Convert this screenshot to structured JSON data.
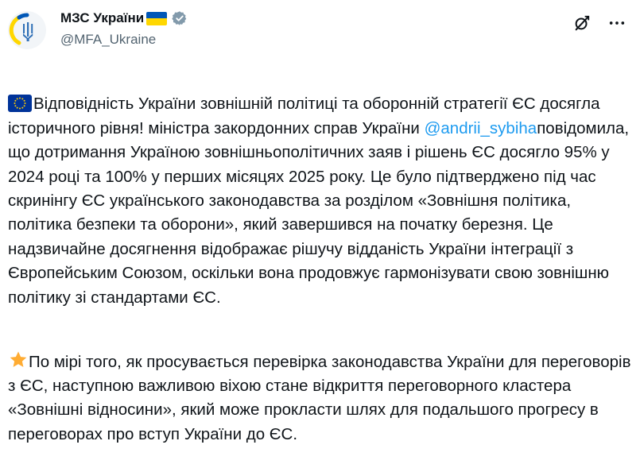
{
  "author": {
    "display_name": "МЗС України",
    "handle": "@MFA_Ukraine"
  },
  "icons": {
    "avatar": "trident-logo",
    "verified": "verified-badge-icon",
    "grok": "grok-icon",
    "more": "more-icon"
  },
  "colors": {
    "accent": "#1d9bf0",
    "ua_blue": "#0057b7",
    "ua_yellow": "#ffd700",
    "eu_blue": "#003399",
    "star": "#ffac33"
  },
  "post": {
    "para1": {
      "text_before": "Відповідність України зовнішній політиці та оборонній стратегії ЄС досягла історичного рівня! міністра закордонних справ України ",
      "mention": "@andrii_sybiha",
      "text_after": "повідомила, що дотримання Україною зовнішньополітичних заяв і рішень ЄС досягло 95% у 2024 році та 100% у перших місяцях 2025 року. Це було підтверджено під час скринінгу ЄС українського законодавства за розділом «Зовнішня політика, політика безпеки та оборони», який завершився на початку березня. Це надзвичайне досягнення відображає рішучу відданість України інтеграції з Європейським Союзом, оскільки вона продовжує гармонізувати свою зовнішню політику зі стандартами ЄС."
    },
    "para2": {
      "text": "По мірі того, як просувається перевірка законодавства України для переговорів з ЄС, наступною важливою віхою стане відкриття переговорного кластера «Зовнішні відносини», який може прокласти шлях для подальшого прогресу в переговорах про вступ України до ЄС."
    }
  }
}
